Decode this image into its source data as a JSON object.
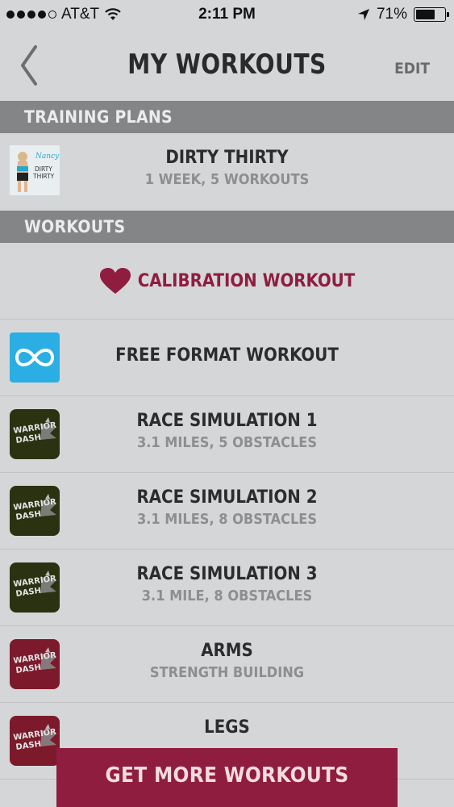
{
  "status_bar": {
    "carrier": "AT&T",
    "time": "2:11 PM",
    "battery_text": "71%",
    "battery_level": 0.71,
    "signal_bars": 4
  },
  "nav": {
    "title": "MY WORKOUTS",
    "edit_label": "EDIT"
  },
  "sections": {
    "training_plans": "TRAINING PLANS",
    "workouts": "WORKOUTS"
  },
  "training_plan": {
    "title": "DIRTY THIRTY",
    "subtitle": "1 WEEK, 5 WORKOUTS",
    "thumb_script": "Nancy",
    "thumb_caption_1": "DIRTY",
    "thumb_caption_2": "THIRTY"
  },
  "calibration": {
    "label": "CALIBRATION WORKOUT",
    "icon": "heart-icon",
    "color": "#8f1d3f"
  },
  "free_format": {
    "label": "FREE FORMAT WORKOUT",
    "icon": "infinity-icon",
    "color": "#2aaee3"
  },
  "logo_text": {
    "line1": "WARRIOR",
    "line2": "DASH"
  },
  "workouts": [
    {
      "title": "RACE SIMULATION 1",
      "subtitle": "3.1 MILES, 5 OBSTACLES",
      "thumb_color": "#2b3212"
    },
    {
      "title": "RACE SIMULATION 2",
      "subtitle": "3.1 MILES, 8 OBSTACLES",
      "thumb_color": "#2b3212"
    },
    {
      "title": "RACE SIMULATION 3",
      "subtitle": "3.1 MILE, 8 OBSTACLES",
      "thumb_color": "#2b3212"
    },
    {
      "title": "ARMS",
      "subtitle": "STRENGTH BUILDING",
      "thumb_color": "#7c1a2c"
    },
    {
      "title": "LEGS",
      "subtitle": "",
      "thumb_color": "#7c1a2c"
    }
  ],
  "cta": {
    "label": "GET MORE WORKOUTS"
  }
}
